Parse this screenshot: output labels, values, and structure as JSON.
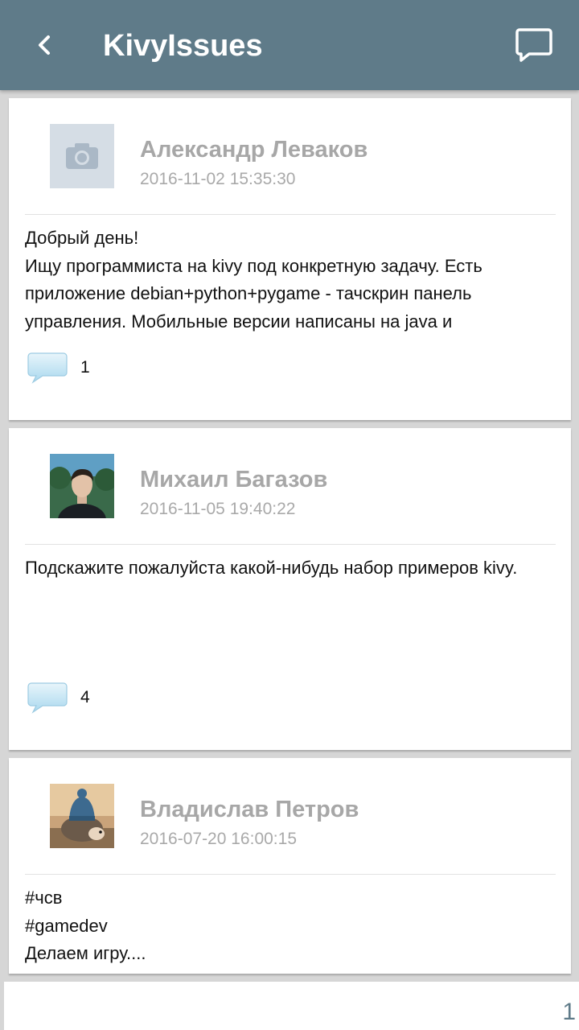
{
  "app": {
    "title": "KivyIssues",
    "back_icon": "chevron-left-icon",
    "comment_icon": "chat-bubble-icon",
    "bar_color": "#5f7b89"
  },
  "posts": [
    {
      "author": "Александр Леваков",
      "date": "2016-11-02 15:35:30",
      "avatar": "camera-placeholder-icon",
      "text": "Добрый день!\nИщу программиста на kivy под конкретную задачу. Есть приложение debian+python+pygame - тачскрин панель управления. Мобильные версии написаны на java и",
      "comments": "1"
    },
    {
      "author": "Михаил Багазов",
      "date": "2016-11-05 19:40:22",
      "avatar": "user-photo",
      "text": "Подскажите пожалуйста какой-нибудь набор примеров kivy.",
      "comments": "4"
    },
    {
      "author": "Владислав Петров",
      "date": "2016-07-20 16:00:15",
      "avatar": "hedgehog-photo",
      "text": "#чсв\n#gamedev\nДелаем игру....",
      "comments": ""
    }
  ],
  "footer": {
    "page_number": "1"
  }
}
